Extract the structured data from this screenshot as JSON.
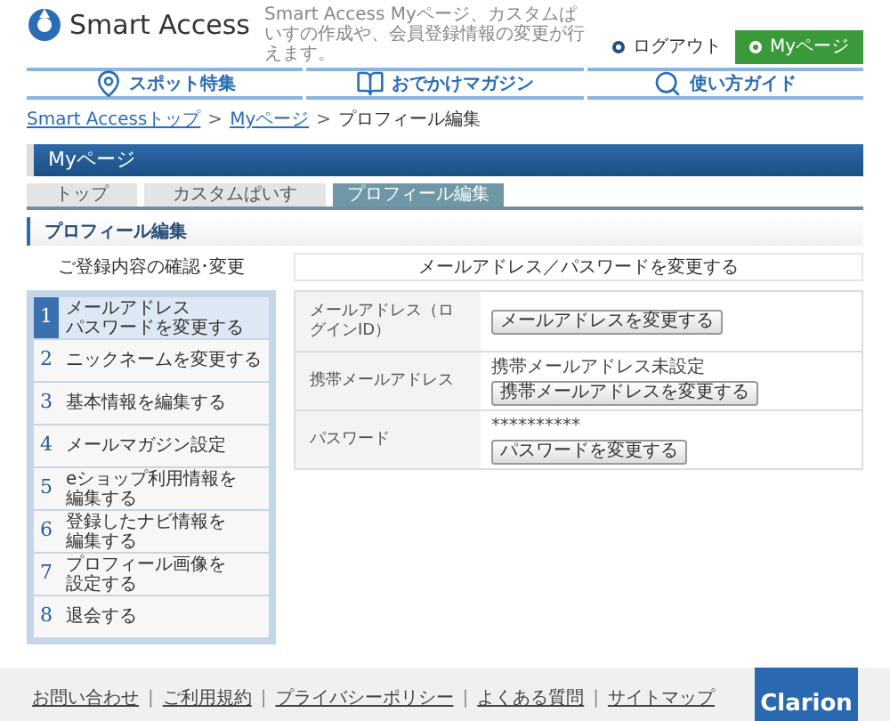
{
  "header": {
    "logo": "Smart Access",
    "description": "Smart Access Myページ、カスタムぱいすの作成や、会員登録情報の変更が行えます。",
    "logout": "ログアウト",
    "mypage_button": "Myページ"
  },
  "nav": [
    {
      "label": "スポット特集",
      "kind": "pin"
    },
    {
      "label": "おでかけマガジン",
      "kind": "book"
    },
    {
      "label": "使い方ガイド",
      "kind": "search"
    }
  ],
  "breadcrumb": {
    "separator": ">",
    "items": [
      {
        "label": "Smart Accessトップ",
        "link": true
      },
      {
        "label": "Myページ",
        "link": true
      },
      {
        "label": "プロフィール編集",
        "link": false
      }
    ]
  },
  "page_title": "Myページ",
  "tabs": [
    {
      "label": "トップ",
      "selected": false
    },
    {
      "label": "カスタムぱいす",
      "selected": false
    },
    {
      "label": "プロフィール編集",
      "selected": true
    }
  ],
  "section_title": "プロフィール編集",
  "sidebar": {
    "heading": "ご登録内容の確認･変更",
    "items": [
      {
        "number": "1",
        "lines": [
          "メールアドレス",
          "パスワードを変更する"
        ],
        "selected": true
      },
      {
        "number": "2",
        "lines": [
          "ニックネームを変更する"
        ],
        "selected": false
      },
      {
        "number": "3",
        "lines": [
          "基本情報を編集する"
        ],
        "selected": false
      },
      {
        "number": "4",
        "lines": [
          "メールマガジン設定"
        ],
        "selected": false
      },
      {
        "number": "5",
        "lines": [
          "eショップ利用情報を",
          "編集する"
        ],
        "selected": false
      },
      {
        "number": "6",
        "lines": [
          "登録したナビ情報を",
          "編集する"
        ],
        "selected": false
      },
      {
        "number": "7",
        "lines": [
          "プロフィール画像を",
          "設定する"
        ],
        "selected": false
      },
      {
        "number": "8",
        "lines": [
          "退会する"
        ],
        "selected": false
      }
    ]
  },
  "main": {
    "heading": "メールアドレス／パスワードを変更する",
    "rows": [
      {
        "label": "メールアドレス（ログインID）",
        "button": "メールアドレスを変更する"
      },
      {
        "label": "携帯メールアドレス",
        "value": "携帯メールアドレス未設定",
        "button": "携帯メールアドレスを変更する"
      },
      {
        "label": "パスワード",
        "value": "**********",
        "button": "パスワードを変更する"
      }
    ]
  },
  "footer": {
    "separator": "|",
    "links": [
      "お問い合わせ",
      "ご利用規約",
      "プライバシーポリシー",
      "よくある質問",
      "サイトマップ"
    ],
    "logo": "Clarion"
  }
}
